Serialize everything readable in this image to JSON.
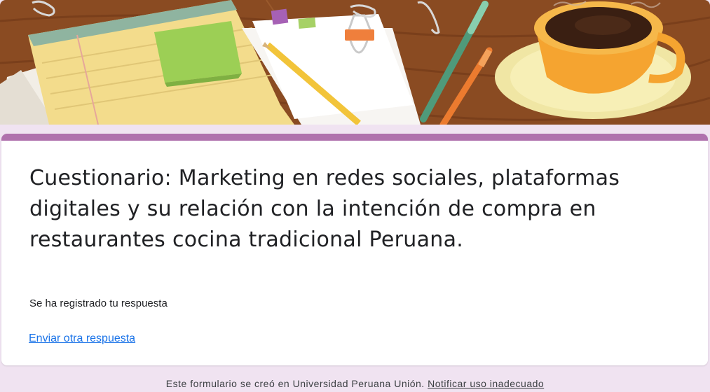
{
  "form": {
    "title": "Cuestionario: Marketing en redes sociales, plataformas digitales y su relación con la intención de compra en restaurantes cocina tradicional Peruana.",
    "confirmation_message": "Se ha registrado tu respuesta",
    "submit_another_label": "Enviar otra respuesta"
  },
  "footer": {
    "created_in_text": "Este formulario se creó en Universidad Peruana Unión.",
    "report_abuse_label": "Notificar uso inadecuado"
  },
  "theme": {
    "accent_color": "#b071ad",
    "background_color": "#f0e3f1",
    "link_color": "#1a73e8"
  },
  "header_image": {
    "icon": "desk-with-coffee-illustration"
  }
}
